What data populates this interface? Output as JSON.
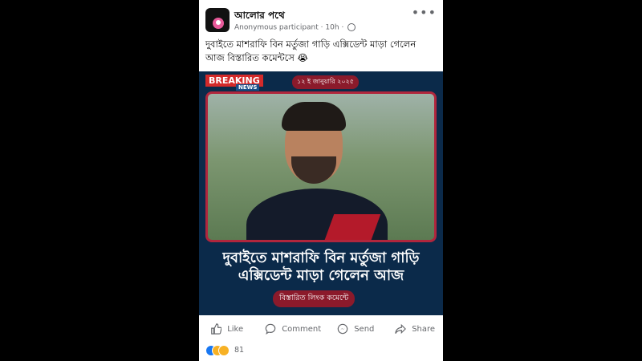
{
  "post": {
    "group_name": "আলোর পথে",
    "author": "Anonymous participant",
    "time": "10h",
    "text": "দুবাইতে মাশরাফি বিন মর্তুজা  গাড়ি এক্সিডেন্ট মাড়া গেলেন আজ বিস্তারিত কমেন্টসে 😭"
  },
  "image": {
    "breaking": "BREAKING",
    "news": "NEWS",
    "date": "১২ ই জানুয়ারি ২০২৫",
    "headline": "দুবাইতে মাশরাফি বিন মর্তুজা  গাড়ি এক্সিডেন্ট মাড়া গেলেন আজ",
    "link_label": "বিস্তারিত লিংক কমেন্টে"
  },
  "actions": {
    "like": "Like",
    "comment": "Comment",
    "send": "Send",
    "share": "Share"
  },
  "reactions": {
    "count": "81",
    "icons": [
      "like",
      "haha",
      "sad"
    ]
  },
  "icons": {
    "more": "more-icon",
    "globe": "globe-icon"
  },
  "colors": {
    "accent_red": "#b0263d",
    "brand_blue": "#1877f2",
    "text_muted": "#65676b"
  }
}
